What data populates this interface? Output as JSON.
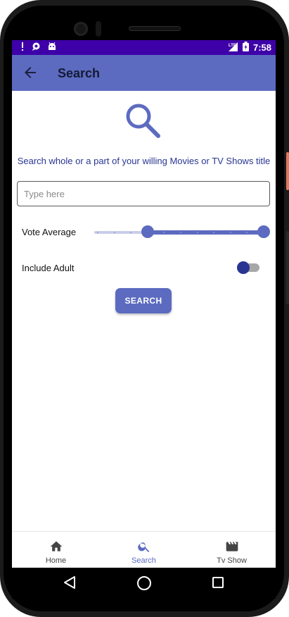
{
  "statusbar": {
    "time": "7:58",
    "network": "LTE",
    "icons": [
      "alert-icon",
      "chat-bubble-icon",
      "android-icon",
      "signal-icon",
      "battery-icon"
    ]
  },
  "appbar": {
    "title": "Search",
    "back_icon": "arrow-back-icon"
  },
  "search": {
    "hint_text": "Search whole or a part of your willing Movies or TV Shows title",
    "placeholder": "Type here",
    "value": "",
    "vote_average_label": "Vote Average",
    "vote_average_range": {
      "min_fraction": 0.3,
      "max_fraction": 1.0
    },
    "include_adult_label": "Include Adult",
    "include_adult_on": false,
    "button_label": "SEARCH"
  },
  "bottom_nav": {
    "items": [
      {
        "label": "Home",
        "icon": "home-icon",
        "active": false
      },
      {
        "label": "Search",
        "icon": "search-icon",
        "active": true
      },
      {
        "label": "Tv Show",
        "icon": "clapperboard-icon",
        "active": false
      }
    ]
  },
  "colors": {
    "primary": "#5c6bc0",
    "primary_dark": "#283593",
    "status_bar": "#3e00a8"
  }
}
